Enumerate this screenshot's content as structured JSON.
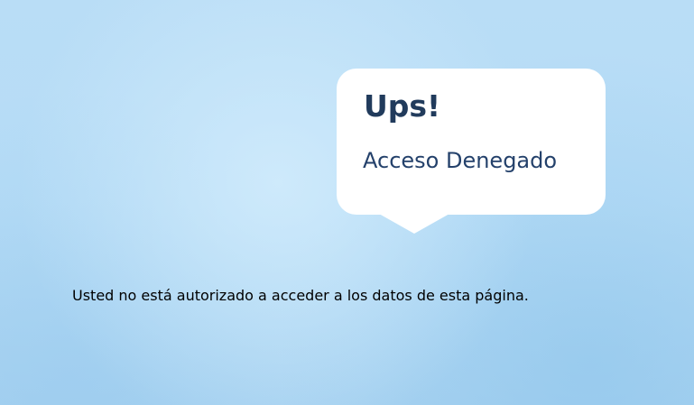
{
  "dialog": {
    "title": "Ups!",
    "subtitle": "Acceso Denegado"
  },
  "message": "Usted no está autorizado a acceder a los datos de esta página.",
  "colors": {
    "background": "#b6dcf6",
    "bubble": "#ffffff",
    "title_text": "#213b5c",
    "subtitle_text": "#24416b",
    "message_text": "#000000"
  }
}
